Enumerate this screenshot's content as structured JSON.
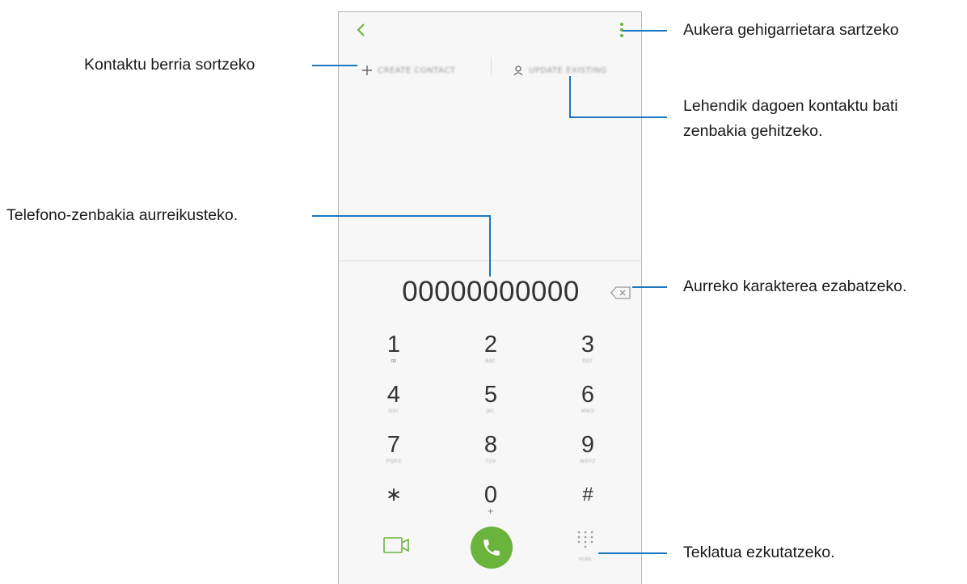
{
  "dialer": {
    "actions": {
      "create_contact": "CREATE CONTACT",
      "update_existing": "UPDATE EXISTING"
    },
    "number": "00000000000",
    "keys": [
      {
        "digit": "1",
        "sub": "∞"
      },
      {
        "digit": "2",
        "sub": "ABC"
      },
      {
        "digit": "3",
        "sub": "DEF"
      },
      {
        "digit": "4",
        "sub": "GHI"
      },
      {
        "digit": "5",
        "sub": "JKL"
      },
      {
        "digit": "6",
        "sub": "MNO"
      },
      {
        "digit": "7",
        "sub": "PQRS"
      },
      {
        "digit": "8",
        "sub": "TUV"
      },
      {
        "digit": "9",
        "sub": "WXYZ"
      },
      {
        "digit": "∗",
        "sub": ""
      },
      {
        "digit": "0",
        "sub": "+"
      },
      {
        "digit": "#",
        "sub": ""
      }
    ],
    "hide_keypad_label": "Hide",
    "accent_color": "#6ab33d"
  },
  "callouts": {
    "more_options": "Aukera gehigarrietara sartzeko",
    "create_contact": "Kontaktu berria sortzeko",
    "update_existing_line1": "Lehendik dagoen kontaktu bati",
    "update_existing_line2": "zenbakia gehitzeko.",
    "preview_number": "Telefono-zenbakia aurreikusteko.",
    "delete_char": "Aurreko karakterea ezabatzeko.",
    "hide_keypad": "Teklatua ezkutatzeko."
  },
  "colors": {
    "callout_line": "#1a78c2",
    "icon_green": "#6ab33d"
  }
}
